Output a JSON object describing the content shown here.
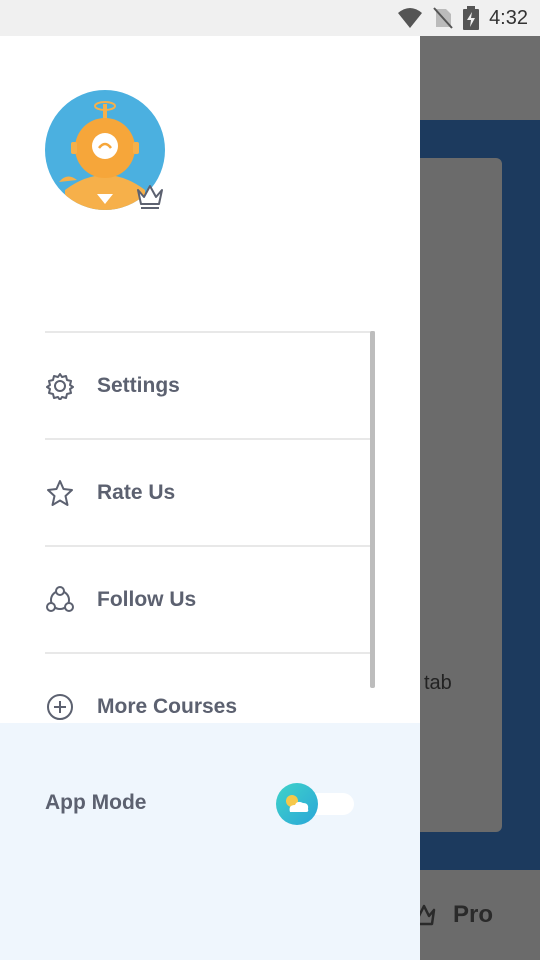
{
  "status_bar": {
    "time": "4:32"
  },
  "background": {
    "card_text": "tab",
    "bottom_tab_label": "Pro"
  },
  "drawer": {
    "menu": [
      {
        "label": "Settings",
        "icon": "gear-icon"
      },
      {
        "label": "Rate Us",
        "icon": "star-icon"
      },
      {
        "label": "Follow Us",
        "icon": "community-icon"
      },
      {
        "label": "More Courses",
        "icon": "plus-circle-icon"
      }
    ],
    "app_mode": {
      "label": "App Mode",
      "toggle_state": "light"
    }
  },
  "colors": {
    "accent": "#2aa6d8",
    "panel": "#eff6fd",
    "text": "#5c6170",
    "bg_blue": "#1c3a5e"
  }
}
